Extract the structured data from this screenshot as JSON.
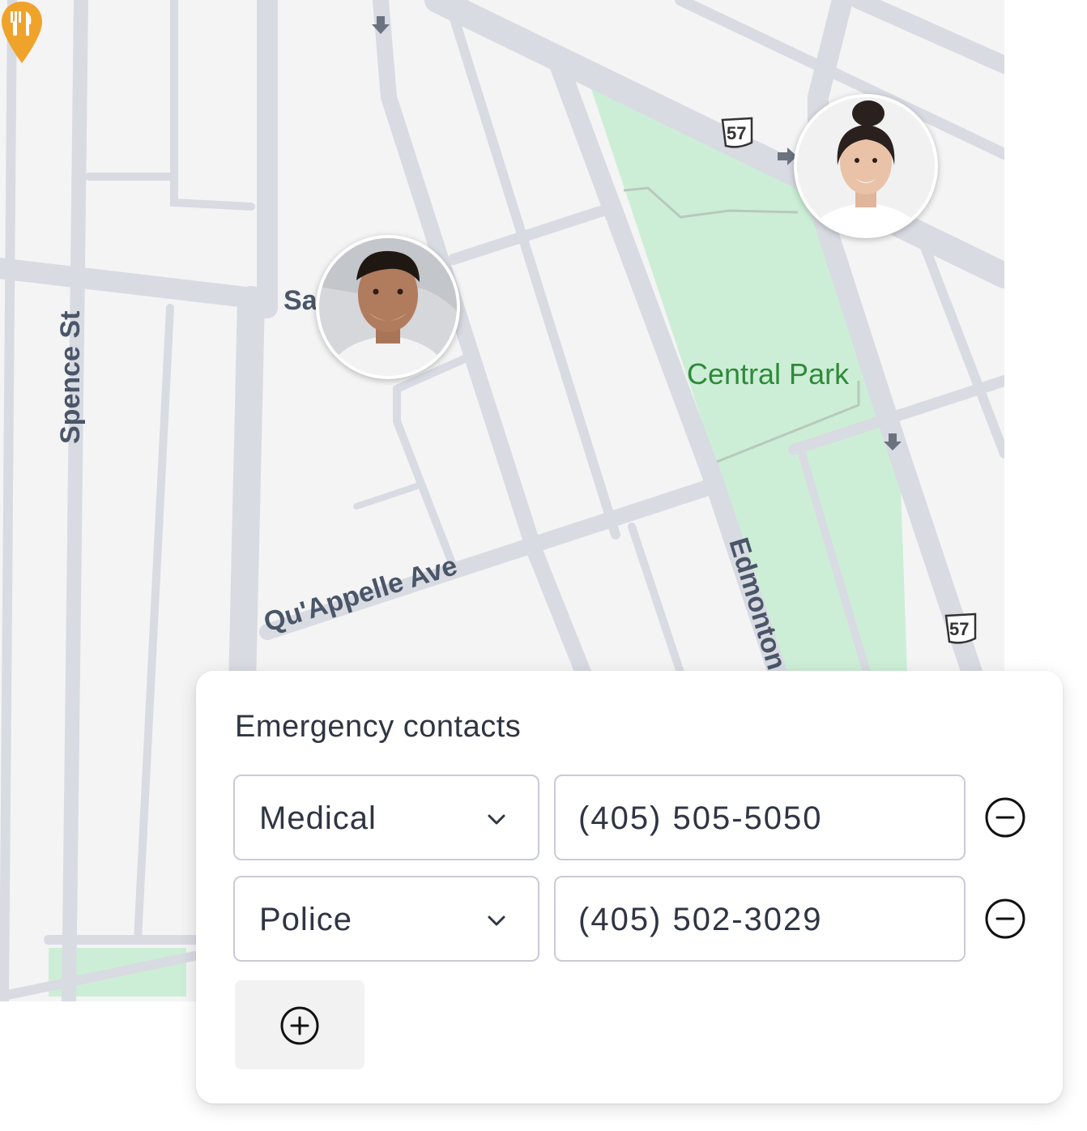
{
  "map": {
    "streets": {
      "spence": "Spence St",
      "sa": "Sa",
      "quappelle": "Qu'Appelle Ave",
      "edmonton": "Edmonton"
    },
    "park": "Central Park",
    "route_shields": [
      "57",
      "57"
    ],
    "poi_icon": "restaurant-icon",
    "colors": {
      "background": "#f4f4f5",
      "road": "#d8dbe2",
      "park": "#cdeed6",
      "poi": "#f0a32a"
    }
  },
  "avatars": [
    {
      "name": "person-avatar-man"
    },
    {
      "name": "person-avatar-woman"
    }
  ],
  "card": {
    "title": "Emergency contacts",
    "contacts": [
      {
        "type": "Medical",
        "phone": "(405) 505-5050"
      },
      {
        "type": "Police",
        "phone": "(405) 502-3029"
      }
    ],
    "icons": {
      "select": "chevron-down-icon",
      "remove": "minus-circle-icon",
      "add": "plus-circle-icon"
    }
  }
}
